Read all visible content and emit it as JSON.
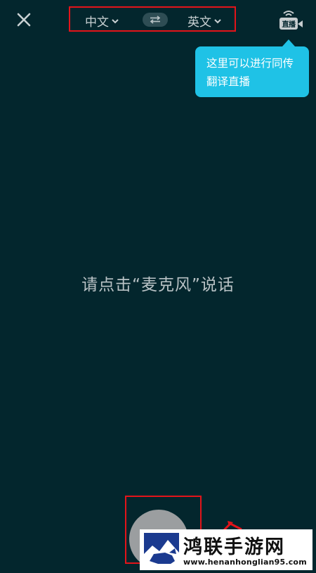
{
  "header": {
    "source_language": "中文",
    "target_language": "英文",
    "live_label": "直播"
  },
  "tooltip": {
    "line1": "这里可以进行同传",
    "line2": "翻译直播"
  },
  "main": {
    "prompt": "请点击“麦克风”说话"
  },
  "watermark": {
    "title": "鸿联手游网",
    "url": "www.henanhonglian95.com"
  },
  "colors": {
    "background": "#03262d",
    "tooltip": "#1fc2e6",
    "highlight_frame": "#e3141a",
    "mic_button": "#9b9ea0"
  }
}
